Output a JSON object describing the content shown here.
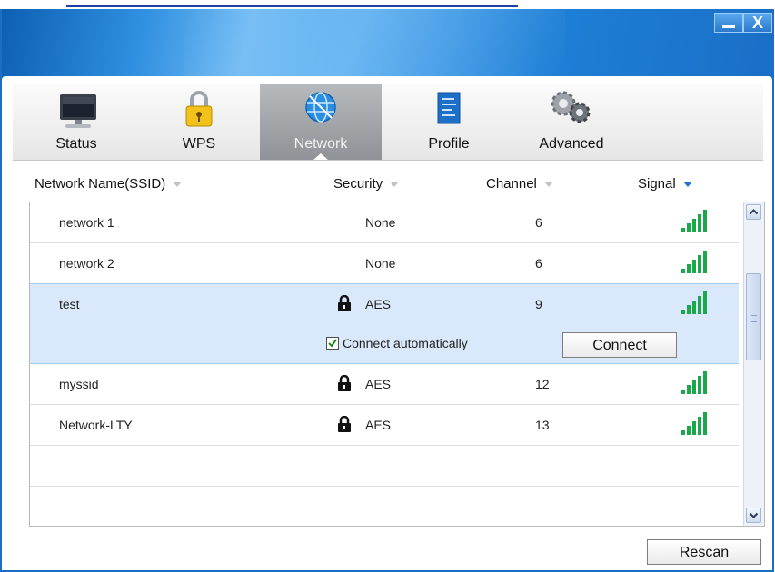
{
  "window": {
    "minimize_glyph": "",
    "close_glyph": "X"
  },
  "tabs": [
    {
      "label": "Status",
      "icon": "monitor-icon"
    },
    {
      "label": "WPS",
      "icon": "padlock-icon"
    },
    {
      "label": "Network",
      "icon": "globe-icon",
      "active": true
    },
    {
      "label": "Profile",
      "icon": "document-icon"
    },
    {
      "label": "Advanced",
      "icon": "gears-icon"
    }
  ],
  "columns": {
    "name": "Network Name(SSID)",
    "security": "Security",
    "channel": "Channel",
    "signal": "Signal",
    "sorted_by": "Signal"
  },
  "networks": [
    {
      "ssid": "network 1",
      "security": "None",
      "locked": false,
      "channel": "6",
      "signal_bars": 5
    },
    {
      "ssid": "network 2",
      "security": "None",
      "locked": false,
      "channel": "6",
      "signal_bars": 5
    },
    {
      "ssid": "test",
      "security": "AES",
      "locked": true,
      "channel": "9",
      "signal_bars": 5,
      "selected": true
    },
    {
      "ssid": "myssid",
      "security": "AES",
      "locked": true,
      "channel": "12",
      "signal_bars": 5
    },
    {
      "ssid": "Network-LTY",
      "security": "AES",
      "locked": true,
      "channel": "13",
      "signal_bars": 5
    }
  ],
  "selected_detail": {
    "auto_connect_label": "Connect automatically",
    "auto_connect_checked": true,
    "connect_label": "Connect"
  },
  "footer": {
    "rescan_label": "Rescan"
  },
  "colors": {
    "accent": "#1e72d0",
    "selection": "#d9e9fb",
    "signal": "#1aa84a"
  }
}
